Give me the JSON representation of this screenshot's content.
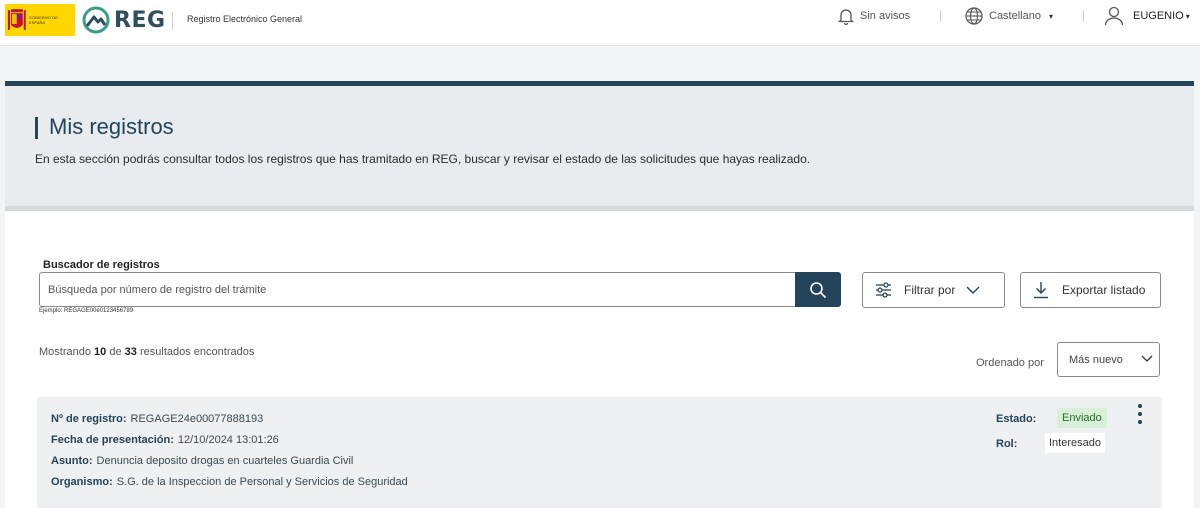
{
  "header": {
    "gov_logo_text": "GOBIERNO DE ESPAÑA",
    "logo_text": "REG",
    "app_title": "Registro Electrónico General",
    "notifications_label": "Sin avisos",
    "language_label": "Castellano",
    "user_label": "EUGENIO",
    "caret": "▾"
  },
  "hero": {
    "title": "Mis registros",
    "description": "En esta sección podrás consultar todos los registros que has tramitado en REG, buscar y revisar el estado de las solicitudes que hayas realizado."
  },
  "search": {
    "label": "Buscador de registros",
    "placeholder": "Búsqueda por número de registro del trámite",
    "hint": "Ejemplo: REGAGE00e0123456789"
  },
  "actions": {
    "filter_label": "Filtrar por",
    "export_label": "Exportar listado"
  },
  "results": {
    "prefix": "Mostrando",
    "shown": "10",
    "middle": "de",
    "total": "33",
    "suffix": "resultados encontrados"
  },
  "sort": {
    "label": "Ordenado por",
    "selected": "Más nuevo"
  },
  "record": {
    "registro_label": "Nº de registro:",
    "registro_value": "REGAGE24e00077888193",
    "fecha_label": "Fecha de presentación:",
    "fecha_value": "12/10/2024 13:01:26",
    "asunto_label": "Asunto:",
    "asunto_value": "Denuncia deposito drogas en cuarteles Guardia Civil",
    "organismo_label": "Organismo:",
    "organismo_value": "S.G. de la Inspeccion de Personal y Servicios de Seguridad",
    "estado_label": "Estado:",
    "estado_value": "Enviado",
    "rol_label": "Rol:",
    "rol_value": "Interesado"
  },
  "colors": {
    "primary": "#23445a",
    "status_sent_bg": "#d9f0d8",
    "gov_yellow": "#ffd700"
  },
  "icons": {
    "notifications": "bell-icon",
    "language": "globe-icon",
    "user": "user-icon",
    "search": "search-icon",
    "filter": "sliders-icon",
    "export": "download-icon",
    "menu": "kebab-menu-icon"
  }
}
